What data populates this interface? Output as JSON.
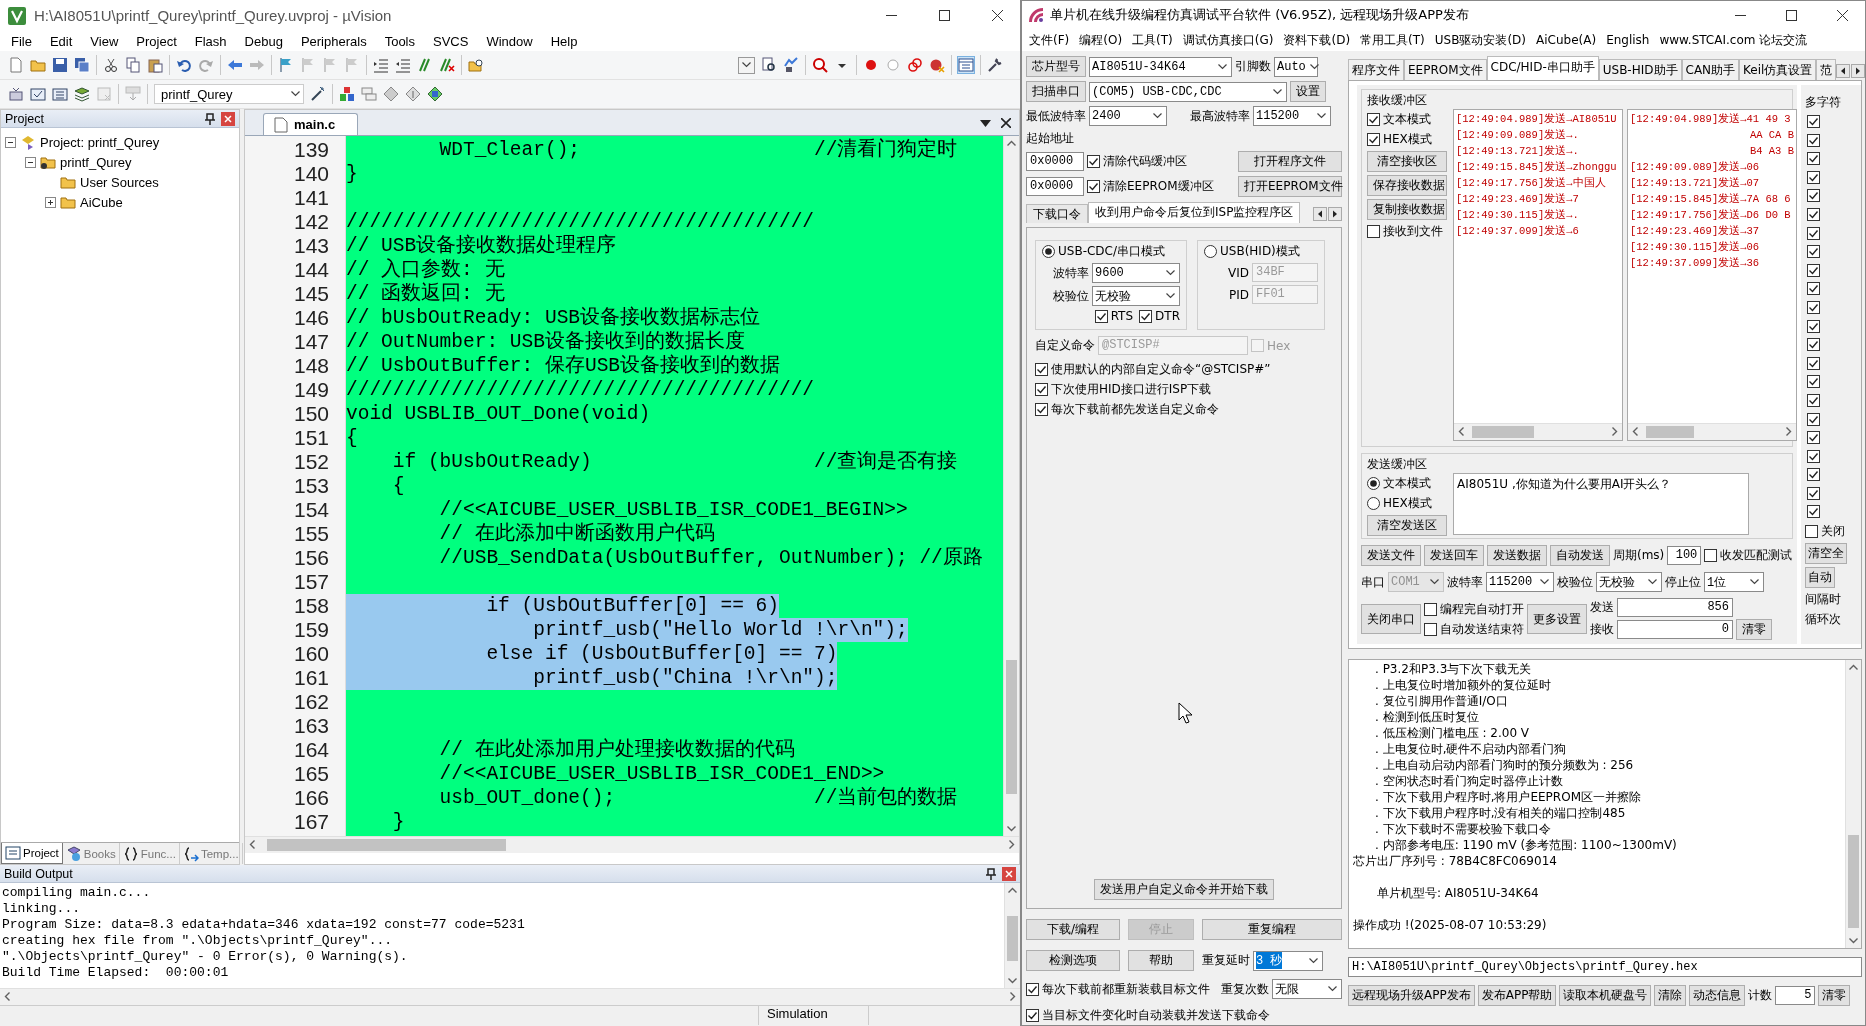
{
  "uvision": {
    "title": "H:\\AI8051U\\printf_Qurey\\printf_Qurey.uvproj - µVision",
    "menu": [
      "File",
      "Edit",
      "View",
      "Project",
      "Flash",
      "Debug",
      "Peripherals",
      "Tools",
      "SVCS",
      "Window",
      "Help"
    ],
    "target": "printf_Qurey",
    "project": {
      "title": "Project",
      "tree": [
        {
          "label": "Project: printf_Qurey",
          "expanded": true,
          "children": [
            {
              "label": "printf_Qurey",
              "expanded": true,
              "children": [
                {
                  "label": "User Sources"
                },
                {
                  "label": "AiCube",
                  "expanded": false
                }
              ]
            }
          ]
        }
      ],
      "tabs": [
        {
          "label": "Project",
          "selected": true
        },
        {
          "label": "Books",
          "selected": false
        },
        {
          "label": "Func...",
          "selected": false
        },
        {
          "label": "Temp...",
          "selected": false
        }
      ]
    },
    "editor": {
      "tabs": [
        {
          "label": "main.c",
          "selected": true
        }
      ],
      "lines": [
        {
          "number": "139",
          "code": "        WDT_Clear();",
          "comment": "//清看门狗定时",
          "selected": false
        },
        {
          "number": "140",
          "code": "}",
          "selected": false
        },
        {
          "number": "141",
          "selected": false
        },
        {
          "number": "142",
          "code": "////////////////////////////////////////",
          "selected": false
        },
        {
          "number": "143",
          "code": "// USB设备接收数据处理程序",
          "selected": false
        },
        {
          "number": "144",
          "code": "// 入口参数: 无",
          "selected": false
        },
        {
          "number": "145",
          "code": "// 函数返回: 无",
          "selected": false
        },
        {
          "number": "146",
          "code": "// bUsbOutReady: USB设备接收数据标志位",
          "selected": false
        },
        {
          "number": "147",
          "code": "// OutNumber: USB设备接收到的数据长度",
          "selected": false
        },
        {
          "number": "148",
          "code": "// UsbOutBuffer: 保存USB设备接收到的数据",
          "selected": false
        },
        {
          "number": "149",
          "code": "////////////////////////////////////////",
          "selected": false
        },
        {
          "number": "150",
          "code": "void USBLIB_OUT_Done(void)",
          "selected": false
        },
        {
          "number": "151",
          "code": "{",
          "selected": false
        },
        {
          "number": "152",
          "code": "    if (bUsbOutReady)",
          "comment": "//查询是否有接",
          "selected": false
        },
        {
          "number": "153",
          "code": "    {",
          "selected": false
        },
        {
          "number": "154",
          "code": "        //<<AICUBE_USER_USBLIB_ISR_CODE1_BEGIN>>",
          "selected": false
        },
        {
          "number": "155",
          "code": "        // 在此添加中断函数用户代码",
          "selected": false
        },
        {
          "number": "156",
          "code": "        //USB_SendData(UsbOutBuffer, OutNumber); //原路",
          "selected": false
        },
        {
          "number": "157",
          "selected": false
        },
        {
          "number": "158",
          "code": "            if (UsbOutBuffer[0] == 6)",
          "selected": true
        },
        {
          "number": "159",
          "code": "                printf_usb(\"Hello World !\\r\\n\");",
          "selected": true
        },
        {
          "number": "160",
          "code": "            else if (UsbOutBuffer[0] == 7)",
          "selected": true
        },
        {
          "number": "161",
          "code": "                printf_usb(\"China !\\r\\n\");",
          "selected": true
        },
        {
          "number": "162",
          "selected": false
        },
        {
          "number": "163",
          "selected": false
        },
        {
          "number": "164",
          "code": "        // 在此处添加用户处理接收数据的代码",
          "selected": false
        },
        {
          "number": "165",
          "code": "        //<<AICUBE_USER_USBLIB_ISR_CODE1_END>>",
          "selected": false
        },
        {
          "number": "166",
          "code": "        usb_OUT_done();",
          "comment": "//当前包的数据",
          "selected": false
        },
        {
          "number": "167",
          "code": "    }",
          "selected": false
        }
      ]
    },
    "build_output": {
      "title": "Build Output",
      "lines": [
        "compiling main.c...",
        "linking...",
        "Program Size: data=8.3 edata+hdata=346 xdata=192 const=77 code=5231",
        "creating hex file from \".\\Objects\\printf_Qurey\"...",
        "\".\\Objects\\printf_Qurey\" - 0 Error(s), 0 Warning(s).",
        "Build Time Elapsed:  00:00:01"
      ]
    },
    "status_bar": {
      "mode": "Simulation"
    }
  },
  "stc": {
    "title": "单片机在线升级编程仿真调试平台软件 (V6.95Z), 远程现场升级APP发布",
    "menu": [
      "文件(F)",
      "编程(O)",
      "工具(T)",
      "调试仿真接口(G)",
      "资料下载(D)",
      "常用工具(T)",
      "USB驱动安装(D)",
      "AiCube(A)",
      "English",
      "www.STCAI.com 论坛交流"
    ],
    "chip": {
      "button": "芯片型号",
      "model": "AI8051U-34K64",
      "pins_label": "引脚数",
      "pins": "Auto"
    },
    "port": {
      "button": "扫描串口",
      "value": "(COM5) USB-CDC,CDC",
      "settings_button": "设置"
    },
    "baud": {
      "min_label": "最低波特率",
      "min": "2400",
      "max_label": "最高波特率",
      "max": "115200"
    },
    "start_address": {
      "label": "起始地址",
      "rows": [
        {
          "address": "0x0000",
          "option": "清除代码缓冲区",
          "checked": true,
          "button": "打开程序文件"
        },
        {
          "address": "0x0000",
          "option": "清除EEPROM缓冲区",
          "checked": true,
          "button": "打开EEPROM文件"
        }
      ]
    },
    "option_tabs": [
      {
        "label": "下载口令",
        "selected": false
      },
      {
        "label": "收到用户命令后复位到ISP监控程序区",
        "selected": true
      }
    ],
    "modes": [
      {
        "kind": "cdc",
        "label": "USB-CDC/串口模式",
        "selected": true,
        "fields": [
          {
            "label": "波特率",
            "value": "9600"
          },
          {
            "label": "校验位",
            "value": "无校验"
          }
        ],
        "flags": [
          {
            "label": "RTS",
            "checked": true
          },
          {
            "label": "DTR",
            "checked": true
          }
        ]
      },
      {
        "kind": "hid",
        "label": "USB(HID)模式",
        "selected": false,
        "fields": [
          {
            "label": "VID",
            "value": "34BF"
          },
          {
            "label": "PID",
            "value": "FF01"
          }
        ]
      }
    ],
    "custom_command": {
      "label": "自定义命令",
      "value": "@STCISP#",
      "hex_label": "Hex",
      "hex_checked": false
    },
    "options": [
      {
        "label": "使用默认的内部自定义命令“@STCISP#”",
        "checked": true
      },
      {
        "label": "下次使用HID接口进行ISP下载",
        "checked": true
      },
      {
        "label": "每次下载前都先发送自定义命令",
        "checked": true
      }
    ],
    "send_command_button": "发送用户自定义命令并开始下载",
    "actions": [
      {
        "label": "下载/编程",
        "disabled": false
      },
      {
        "label": "停止",
        "disabled": true
      },
      {
        "label": "重复编程",
        "disabled": false
      },
      {
        "label": "检测选项",
        "disabled": false
      },
      {
        "label": "帮助",
        "disabled": false
      }
    ],
    "repeat": [
      {
        "label": "重复延时",
        "value": "3 秒",
        "highlighted": true
      },
      {
        "label": "重复次数",
        "value": "无限",
        "highlighted": false
      }
    ],
    "reload_options": [
      {
        "label": "每次下载前都重新装载目标文件",
        "checked": true
      },
      {
        "label": "当目标文件变化时自动装载并发送下载命令",
        "checked": true
      }
    ],
    "tabs": [
      {
        "label": "程序文件",
        "selected": false
      },
      {
        "label": "EEPROM文件",
        "selected": false
      },
      {
        "label": "CDC/HID-串口助手",
        "selected": true
      },
      {
        "label": "USB-HID助手",
        "selected": false
      },
      {
        "label": "CAN助手",
        "selected": false
      },
      {
        "label": "Keil仿真设置",
        "selected": false
      },
      {
        "label": "范",
        "selected": false
      }
    ],
    "receive": {
      "title": "接收缓冲区",
      "modes": [
        {
          "label": "文本模式",
          "checked": true
        },
        {
          "label": "HEX模式",
          "checked": true
        }
      ],
      "buttons": [
        "清空接收区",
        "保存接收数据",
        "复制接收数据"
      ],
      "to_file": {
        "label": "接收到文件",
        "checked": false
      },
      "text_pane": [
        "[12:49:04.989]发送→AI8051U",
        "[12:49:09.089]发送→.",
        "[12:49:13.721]发送→.",
        "[12:49:15.845]发送→zhonggu",
        "[12:49:17.756]发送→中国人",
        "[12:49:23.469]发送→7",
        "[12:49:30.115]发送→.",
        "[12:49:37.099]发送→6"
      ],
      "hex_pane": [
        {
          "kind": "entry",
          "text": "[12:49:04.989]发送→41 49 3"
        },
        {
          "kind": "wrap",
          "text": "AA CA B"
        },
        {
          "kind": "wrap",
          "text": "B4 A3 B"
        },
        {
          "kind": "entry",
          "text": "[12:49:09.089]发送→06"
        },
        {
          "kind": "entry",
          "text": "[12:49:13.721]发送→07"
        },
        {
          "kind": "entry",
          "text": "[12:49:15.845]发送→7A 68 6"
        },
        {
          "kind": "entry",
          "text": "[12:49:17.756]发送→D6 D0 B"
        },
        {
          "kind": "entry",
          "text": "[12:49:23.469]发送→37"
        },
        {
          "kind": "entry",
          "text": "[12:49:30.115]发送→06"
        },
        {
          "kind": "entry",
          "text": "[12:49:37.099]发送→36"
        }
      ]
    },
    "multi_string": {
      "label": "多字符",
      "items": [
        {
          "checked": true
        },
        {
          "checked": true
        },
        {
          "checked": true
        },
        {
          "checked": true
        },
        {
          "checked": true
        },
        {
          "checked": true
        },
        {
          "checked": true
        },
        {
          "checked": true
        },
        {
          "checked": true
        },
        {
          "checked": true
        },
        {
          "checked": true
        },
        {
          "checked": true
        },
        {
          "checked": true
        },
        {
          "checked": true
        },
        {
          "checked": true
        },
        {
          "checked": true
        },
        {
          "checked": true
        },
        {
          "checked": true
        },
        {
          "checked": true
        },
        {
          "checked": true
        },
        {
          "checked": true
        },
        {
          "checked": true
        }
      ],
      "close": {
        "label": "关闭",
        "checked": false
      },
      "buttons": [
        "清空全",
        "自动"
      ],
      "notes": [
        "间隔时",
        "循环次"
      ]
    },
    "send": {
      "title": "发送缓冲区",
      "modes": [
        {
          "label": "文本模式",
          "selected": true
        },
        {
          "label": "HEX模式",
          "selected": false
        }
      ],
      "clear_button": "清空发送区",
      "text": "AI8051U ,你知道为什么要用AI开头么？"
    },
    "send_buttons": [
      "发送文件",
      "发送回车",
      "发送数据",
      "自动发送"
    ],
    "period": {
      "label": "周期(ms)",
      "value": "100"
    },
    "match_test": {
      "label": "收发匹配测试",
      "checked": false
    },
    "serial": {
      "port_label": "串口",
      "port": "COM1",
      "port_disabled": true,
      "baud_label": "波特率",
      "baud": "115200",
      "parity_label": "校验位",
      "parity": "无校验",
      "stop_label": "停止位",
      "stop": "1位"
    },
    "close_port_button": "关闭串口",
    "auto_options": [
      {
        "label": "编程完自动打开",
        "checked": false
      },
      {
        "label": "自动发送结束符",
        "checked": false
      }
    ],
    "more_button": "更多设置",
    "counters": [
      {
        "label": "发送",
        "value": "856"
      },
      {
        "label": "接收",
        "value": "0"
      }
    ],
    "clear_counters_button": "清零",
    "log": [
      {
        "kind": "item",
        "text": ". P3.2和P3.3与下次下载无关"
      },
      {
        "kind": "item",
        "text": ". 上电复位时增加额外的复位延时"
      },
      {
        "kind": "item",
        "text": ". 复位引脚用作普通I/O口"
      },
      {
        "kind": "item",
        "text": ". 检测到低压时复位"
      },
      {
        "kind": "item",
        "text": ". 低压检测门槛电压 : 2.00 V"
      },
      {
        "kind": "item",
        "text": ". 上电复位时,硬件不启动内部看门狗"
      },
      {
        "kind": "item",
        "text": ". 上电自动启动内部看门狗时的预分频数为 : 256"
      },
      {
        "kind": "item",
        "text": ". 空闲状态时看门狗定时器停止计数"
      },
      {
        "kind": "item",
        "text": ". 下次下载用户程序时,将用户EEPROM区一并擦除"
      },
      {
        "kind": "item",
        "text": ". 下次下载用户程序时,没有相关的端口控制485"
      },
      {
        "kind": "item",
        "text": ". 下次下载时不需要校验下载口令"
      },
      {
        "kind": "item",
        "text": ". 内部参考电压: 1190 mV (参考范围: 1100~1300mV)"
      },
      {
        "kind": "text",
        "text": "芯片出厂序列号 : 78B4C8FC069014"
      },
      {
        "kind": "gap"
      },
      {
        "kind": "indent",
        "text": "单片机型号: AI8051U-34K64"
      },
      {
        "kind": "gap"
      },
      {
        "kind": "text",
        "text": "操作成功 !(2025-08-07 10:53:29)"
      }
    ],
    "hex_path": "H:\\AI8051U\\printf_Qurey\\Objects\\printf_Qurey.hex",
    "footer_buttons": [
      "远程现场升级APP发布",
      "发布APP帮助",
      "读取本机硬盘号",
      "清除",
      "动态信息"
    ],
    "count": {
      "label": "计数",
      "value": "5"
    },
    "count_clear_button": "清零"
  }
}
